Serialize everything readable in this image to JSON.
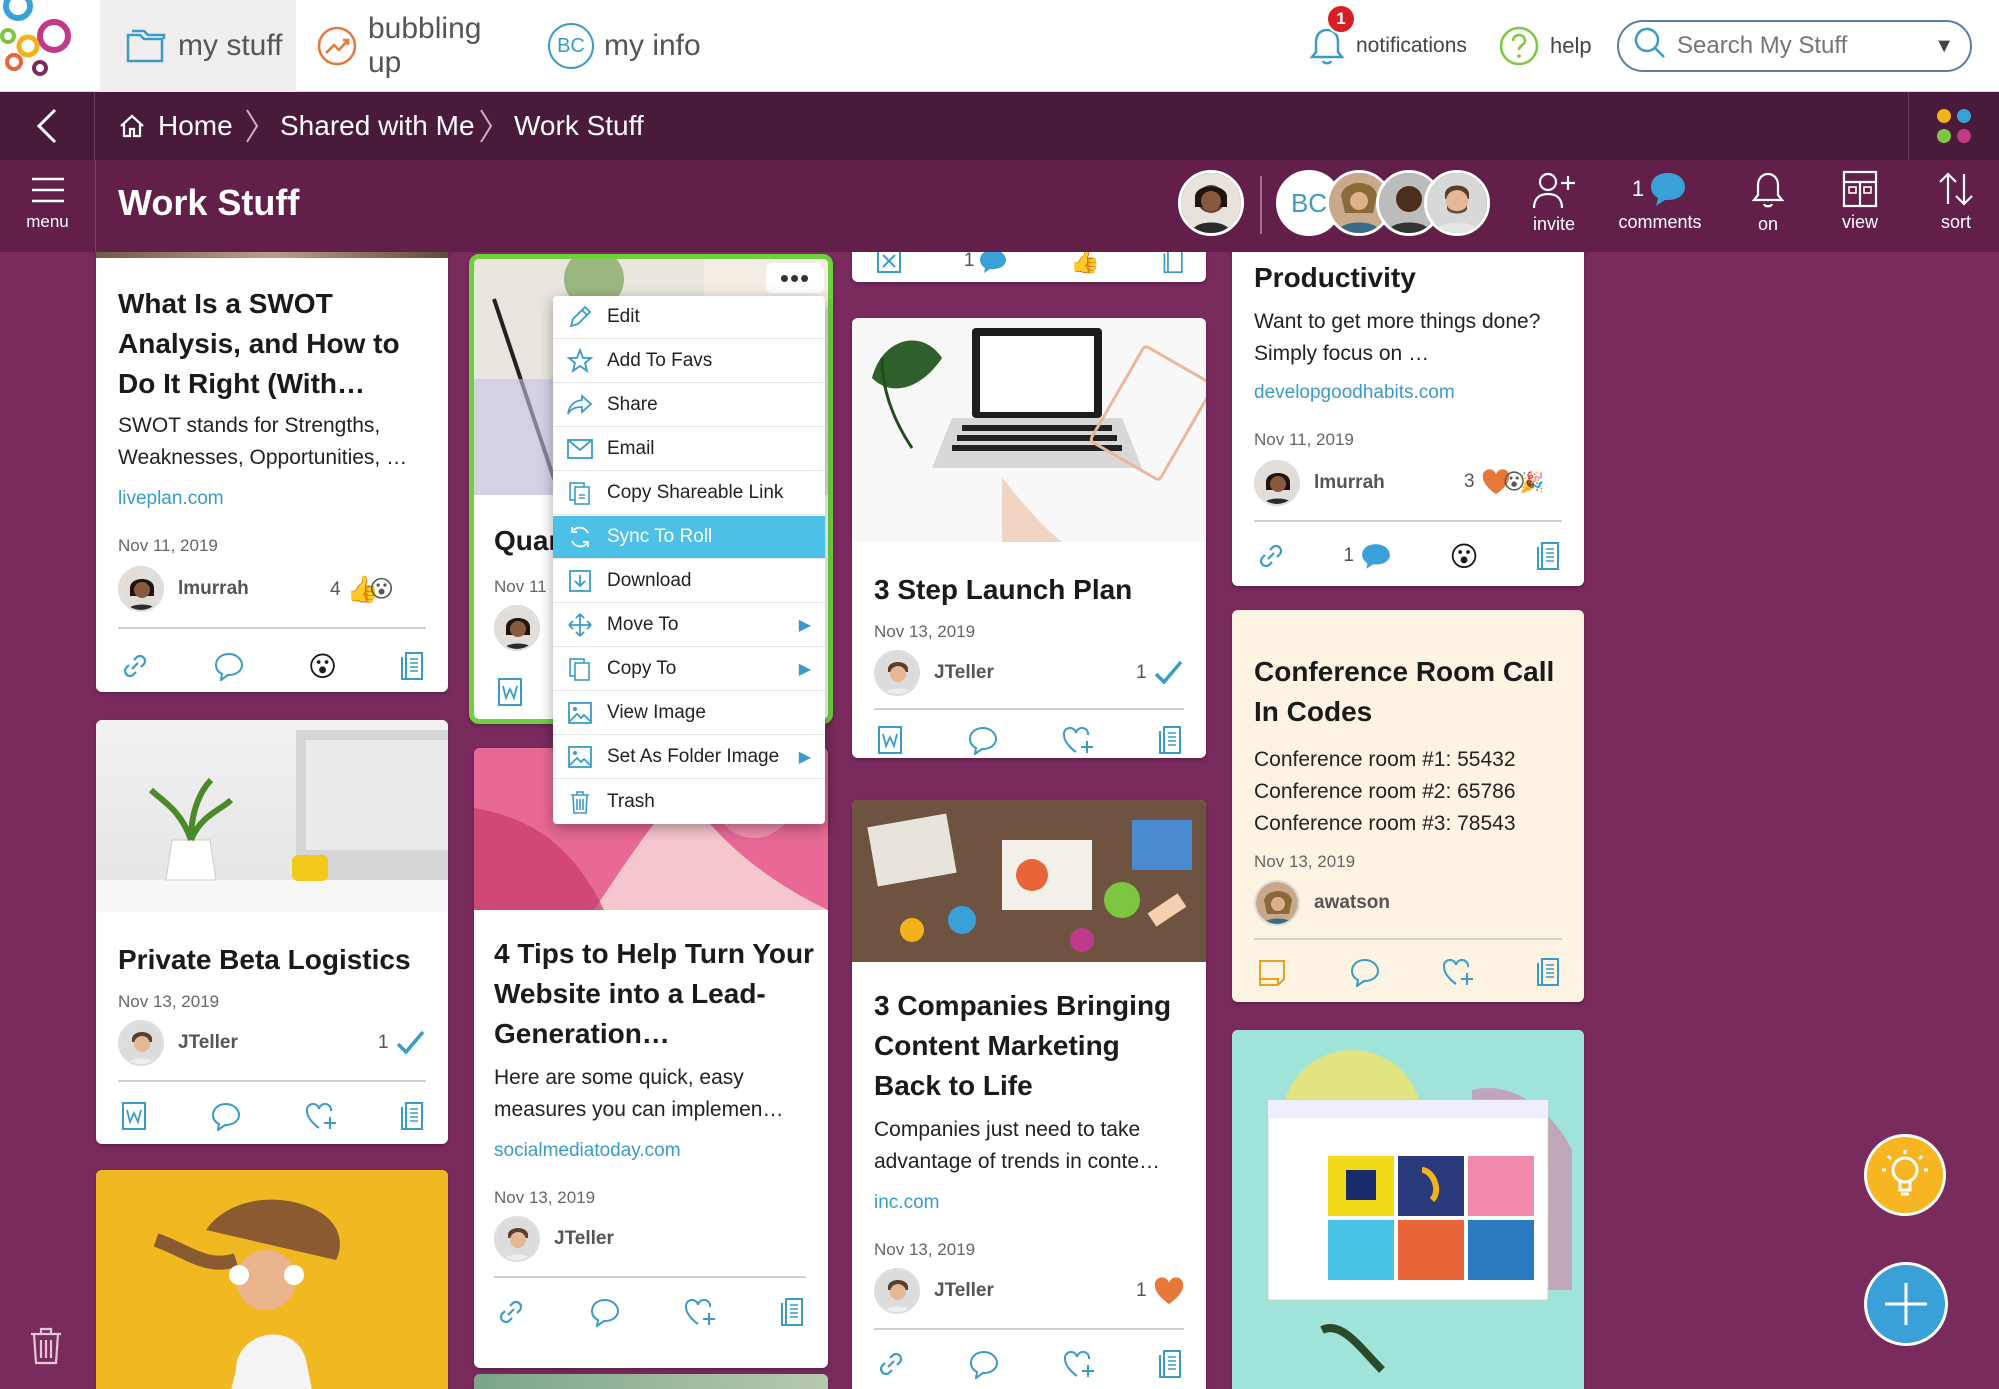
{
  "topnav": {
    "tabs": [
      {
        "label": "my stuff",
        "icon": "folders-icon",
        "active": true
      },
      {
        "label": "bubbling up",
        "icon": "trend-icon",
        "active": false
      },
      {
        "label": "my info",
        "icon": "bc-avatar-icon",
        "active": false
      }
    ],
    "avatar_initials": "BC",
    "notifications_label": "notifications",
    "notifications_count": "1",
    "help_label": "help",
    "search_placeholder": "Search My Stuff"
  },
  "breadcrumb": {
    "items": [
      "Home",
      "Shared with Me",
      "Work Stuff"
    ]
  },
  "folder": {
    "title": "Work Stuff",
    "member_initials": "BC",
    "tools": {
      "menu": "menu",
      "invite": "invite",
      "comments": "comments",
      "comments_count": "1",
      "on": "on",
      "view": "view",
      "sort": "sort"
    }
  },
  "context_menu": {
    "items": [
      {
        "label": "Edit",
        "icon": "pencil-icon",
        "submenu": false,
        "selected": false
      },
      {
        "label": "Add To Favs",
        "icon": "star-icon",
        "submenu": false,
        "selected": false
      },
      {
        "label": "Share",
        "icon": "share-icon",
        "submenu": false,
        "selected": false
      },
      {
        "label": "Email",
        "icon": "envelope-icon",
        "submenu": false,
        "selected": false
      },
      {
        "label": "Copy Shareable Link",
        "icon": "copy-link-icon",
        "submenu": false,
        "selected": false
      },
      {
        "label": "Sync To Roll",
        "icon": "sync-icon",
        "submenu": false,
        "selected": true
      },
      {
        "label": "Download",
        "icon": "download-icon",
        "submenu": false,
        "selected": false
      },
      {
        "label": "Move To",
        "icon": "move-icon",
        "submenu": true,
        "selected": false
      },
      {
        "label": "Copy To",
        "icon": "copy-icon",
        "submenu": true,
        "selected": false
      },
      {
        "label": "View Image",
        "icon": "image-icon",
        "submenu": false,
        "selected": false
      },
      {
        "label": "Set As Folder Image",
        "icon": "folder-image-icon",
        "submenu": true,
        "selected": false
      },
      {
        "label": "Trash",
        "icon": "trash-icon",
        "submenu": false,
        "selected": false
      }
    ]
  },
  "cards": {
    "swot": {
      "title": "What Is a SWOT Analysis, and How to Do It Right (With…",
      "desc": "SWOT stands for Strengths, Weaknesses, Opportunities, …",
      "link": "liveplan.com",
      "date": "Nov 11, 2019",
      "user": "lmurrah",
      "reaction_count": "4"
    },
    "quarterly": {
      "title": "Quar",
      "date": "Nov 11"
    },
    "launch": {
      "title": "3 Step Launch Plan",
      "date": "Nov 13, 2019",
      "user": "JTeller",
      "check_count": "1",
      "top_count": "1"
    },
    "productivity": {
      "title": "Productivity",
      "desc": "Want to get more things done? Simply focus on …",
      "link": "developgoodhabits.com",
      "date": "Nov 11, 2019",
      "user": "lmurrah",
      "reaction_count": "3",
      "comment_count": "1"
    },
    "beta": {
      "title": "Private Beta Logistics",
      "date": "Nov 13, 2019",
      "user": "JTeller",
      "check_count": "1"
    },
    "tips": {
      "title": "4 Tips to Help Turn Your Website into a Lead-Generation…",
      "desc": "Here are some quick, easy measures you can implemen…",
      "link": "socialmediatoday.com",
      "date": "Nov 13, 2019",
      "user": "JTeller"
    },
    "companies": {
      "title": "3 Companies Bringing Content Marketing Back to Life",
      "desc": "Companies just need to take advantage of trends in conte…",
      "link": "inc.com",
      "date": "Nov 13, 2019",
      "user": "JTeller",
      "heart_count": "1"
    },
    "conference": {
      "title": "Conference Room Call In Codes",
      "line1": "Conference room #1: 55432",
      "line2": "Conference room #2: 65786",
      "line3": "Conference room #3: 78543",
      "date": "Nov 13, 2019",
      "user": "awatson"
    }
  },
  "colors": {
    "board_bg": "#7a2b5e",
    "accent": "#3a9bc8",
    "selected": "#4cc0e6",
    "note_bg": "#fdf3e2",
    "highlight_border": "#6ed03c"
  }
}
